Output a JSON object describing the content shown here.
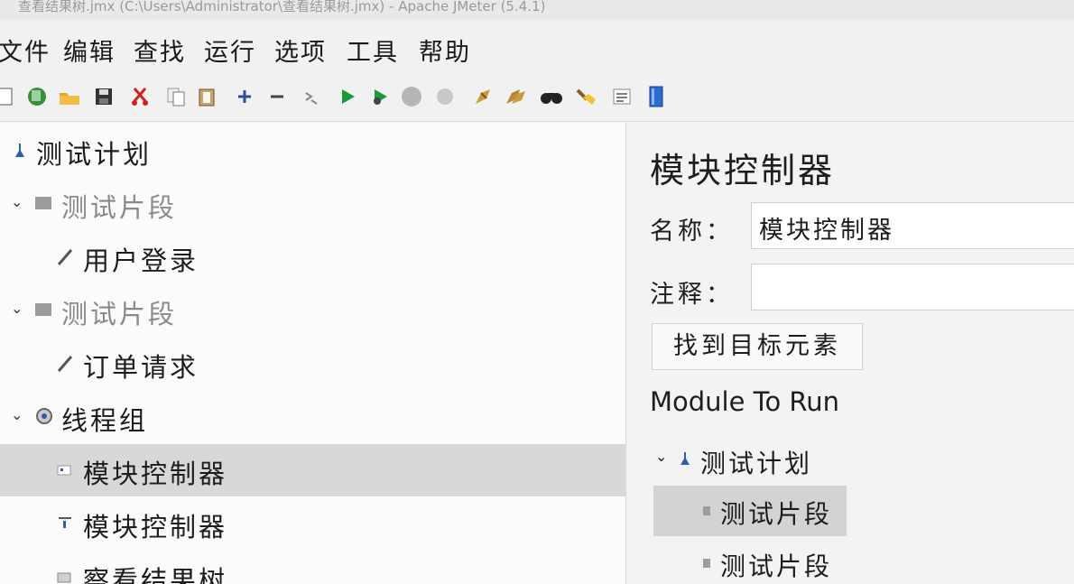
{
  "window": {
    "title": "查看结果树.jmx (C:\\Users\\Administrator\\查看结果树.jmx) - Apache JMeter (5.4.1)"
  },
  "menu": [
    "文件",
    "编辑",
    "查找",
    "运行",
    "选项",
    "工具",
    "帮助"
  ],
  "toolbar": [
    "new-icon",
    "templates-icon",
    "open-icon",
    "save-icon",
    "cut-icon",
    "copy-icon",
    "paste-icon",
    "expand-icon",
    "collapse-icon",
    "toggle-icon",
    "start-icon",
    "start-no-timers-icon",
    "stop-icon",
    "shutdown-icon",
    "clear-icon",
    "clear-all-icon",
    "search-icon",
    "reset-search-icon",
    "function-helper-icon",
    "help-icon"
  ],
  "tree": {
    "items": [
      {
        "label": "测试计划",
        "icon": "test-plan-icon",
        "expanded": true,
        "disabled": false
      },
      {
        "label": "测试片段",
        "icon": "fragment-icon",
        "expanded": true,
        "disabled": true
      },
      {
        "label": "用户登录",
        "icon": "sampler-icon",
        "disabled": false
      },
      {
        "label": "测试片段",
        "icon": "fragment-icon",
        "expanded": true,
        "disabled": true
      },
      {
        "label": "订单请求",
        "icon": "sampler-icon",
        "disabled": false
      },
      {
        "label": "线程组",
        "icon": "thread-group-icon",
        "expanded": true,
        "disabled": false
      },
      {
        "label": "模块控制器",
        "icon": "module-controller-icon",
        "selected": true,
        "disabled": false
      },
      {
        "label": "模块控制器",
        "icon": "module-controller-icon",
        "disabled": false
      },
      {
        "label": "察看结果树",
        "icon": "listener-icon",
        "disabled": false
      }
    ]
  },
  "panel": {
    "title": "模块控制器",
    "name_label": "名称：",
    "name_value": "模块控制器",
    "comment_label": "注释：",
    "comment_value": "",
    "find_button": "找到目标元素",
    "module_to_run": "Module To Run",
    "module_tree": [
      {
        "label": "测试计划",
        "expanded": true
      },
      {
        "label": "测试片段",
        "selected": true
      },
      {
        "label": "测试片段"
      }
    ]
  }
}
